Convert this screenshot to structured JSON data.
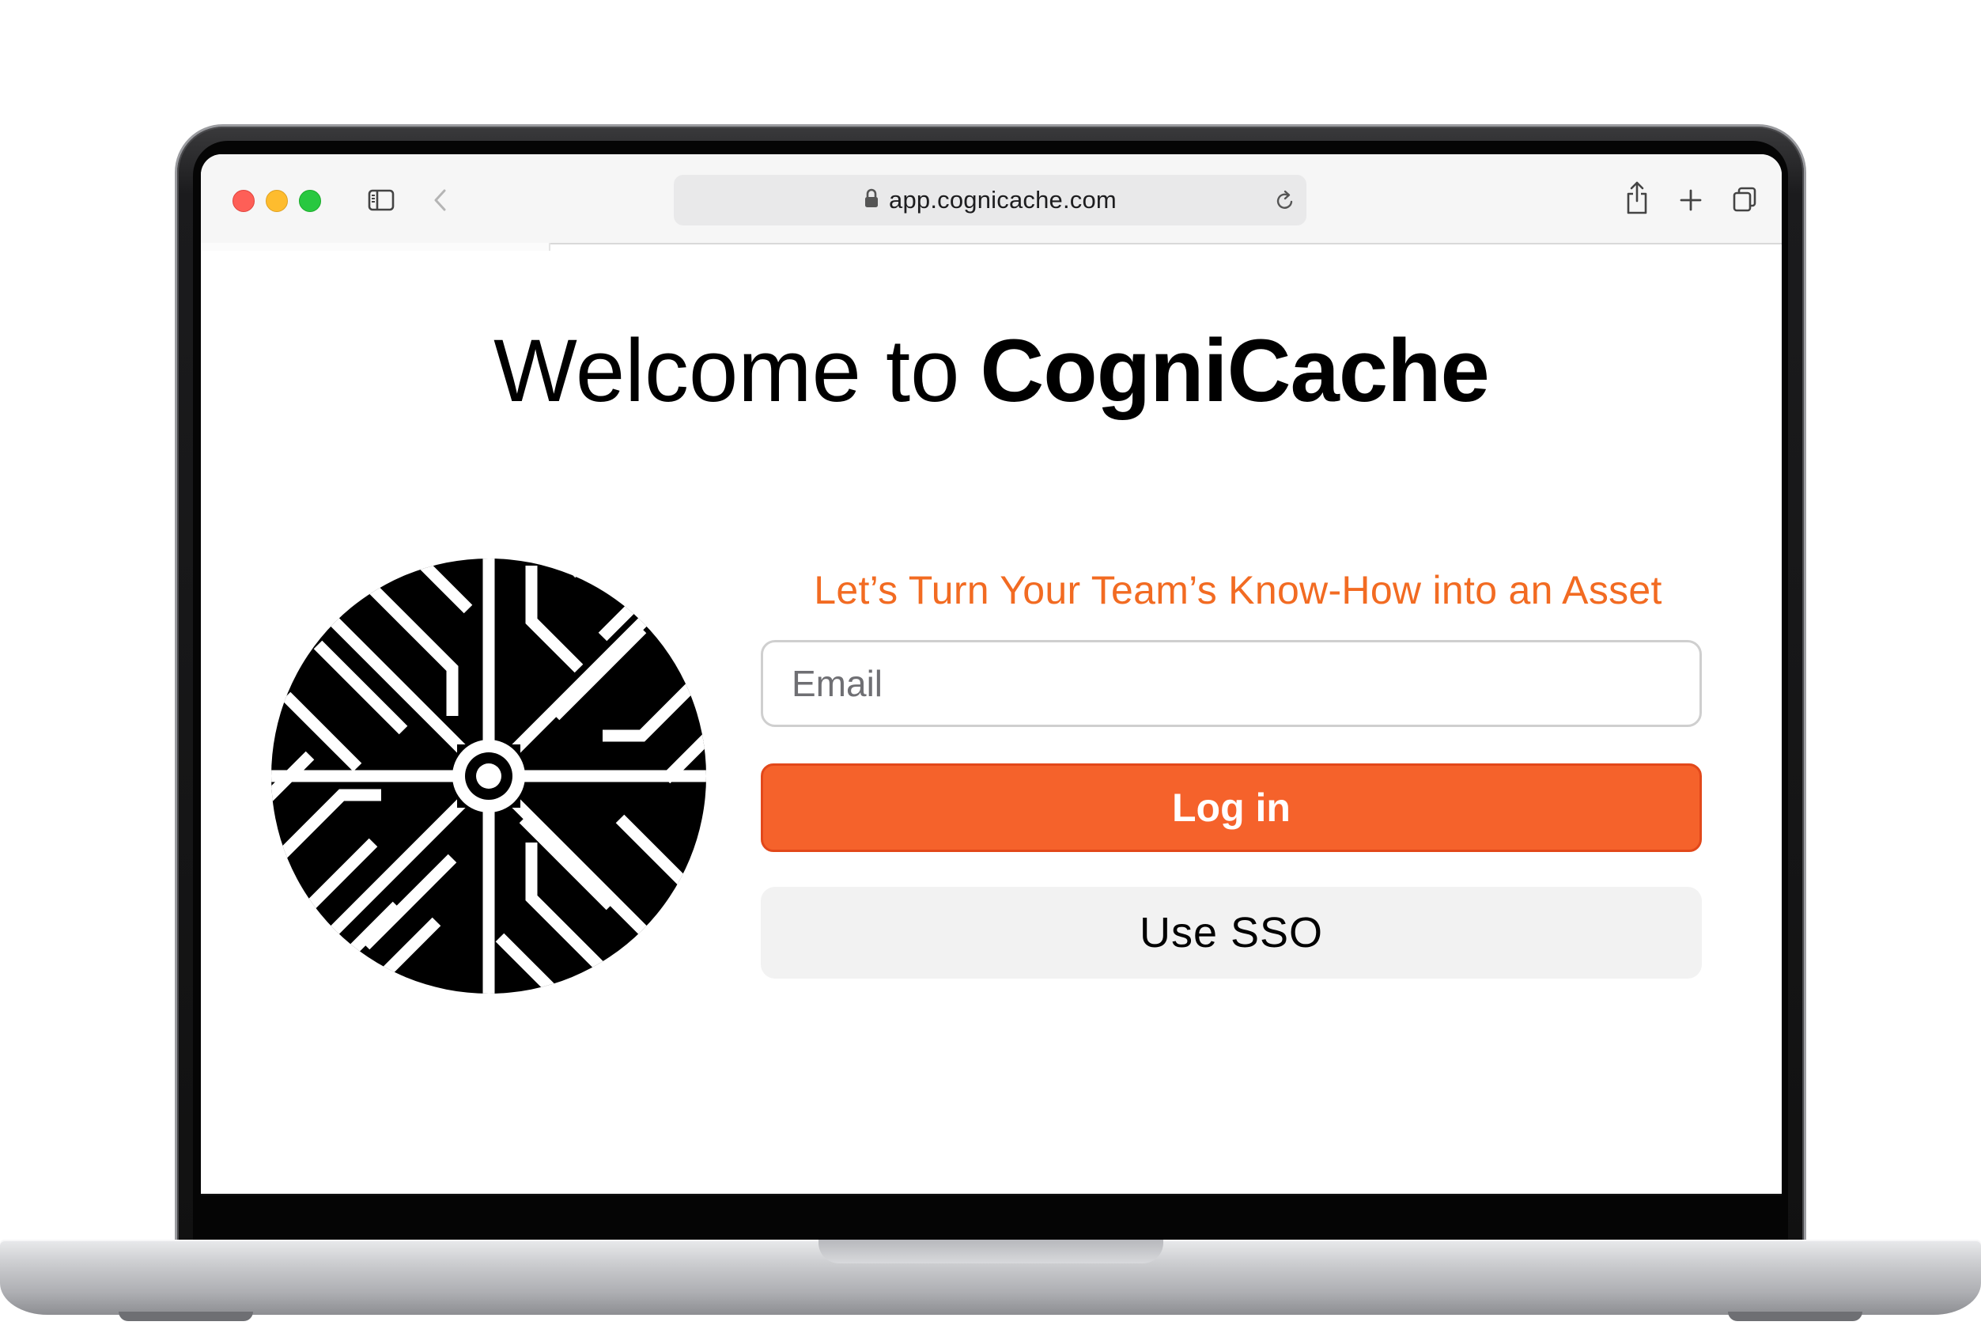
{
  "browser": {
    "url": "app.cognicache.com",
    "icons": [
      "sidebar-icon",
      "back-icon",
      "lock-icon",
      "reload-icon",
      "share-icon",
      "new-tab-icon",
      "tabs-overview-icon"
    ]
  },
  "page": {
    "welcome_prefix": "Welcome to",
    "brand_name": "CogniCache",
    "tagline": "Let’s Turn Your Team’s Know-How into an Asset",
    "email_placeholder": "Email",
    "email_value": "",
    "login_label": "Log in",
    "sso_label": "Use SSO"
  },
  "colors": {
    "accent": "#f5622b",
    "tagline": "#f26b22",
    "sso_bg": "#f2f2f2",
    "logo": "#000000"
  }
}
